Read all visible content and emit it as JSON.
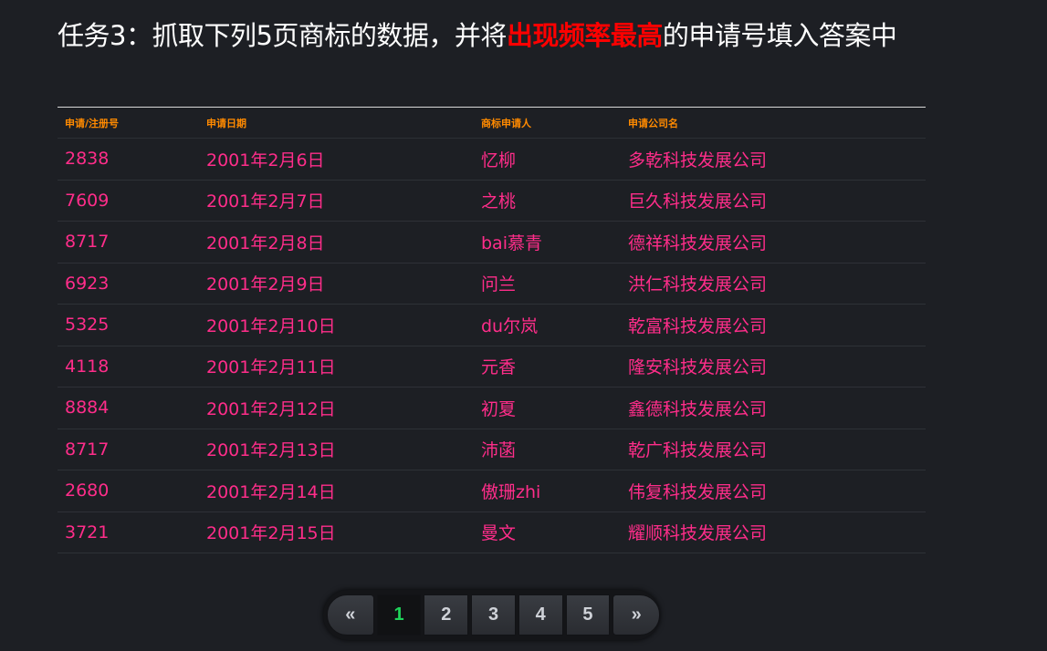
{
  "title": {
    "prefix": "任务3：抓取下列5页商标的数据，并将",
    "highlight": "出现频率最高",
    "suffix": "的申请号填入答案中"
  },
  "table": {
    "headers": [
      "申请/注册号",
      "申请日期",
      "商标申请人",
      "申请公司名"
    ],
    "rows": [
      [
        "2838",
        "2001年2月6日",
        "忆柳",
        "多乾科技发展公司"
      ],
      [
        "7609",
        "2001年2月7日",
        "之桃",
        "巨久科技发展公司"
      ],
      [
        "8717",
        "2001年2月8日",
        "bai慕青",
        "德祥科技发展公司"
      ],
      [
        "6923",
        "2001年2月9日",
        "问兰",
        "洪仁科技发展公司"
      ],
      [
        "5325",
        "2001年2月10日",
        "du尔岚",
        "乾富科技发展公司"
      ],
      [
        "4118",
        "2001年2月11日",
        "元香",
        "隆安科技发展公司"
      ],
      [
        "8884",
        "2001年2月12日",
        "初夏",
        "鑫德科技发展公司"
      ],
      [
        "8717",
        "2001年2月13日",
        "沛菡",
        "乾广科技发展公司"
      ],
      [
        "2680",
        "2001年2月14日",
        "傲珊zhi",
        "伟复科技发展公司"
      ],
      [
        "3721",
        "2001年2月15日",
        "曼文",
        "耀顺科技发展公司"
      ]
    ]
  },
  "pagination": {
    "prev": "«",
    "next": "»",
    "pages": [
      "1",
      "2",
      "3",
      "4",
      "5"
    ],
    "active": "1"
  },
  "colors": {
    "background": "#1d1f24",
    "title": "#ffffff",
    "highlight": "#ff0000",
    "header": "#ff8a00",
    "cell": "#ff2d8a",
    "active_page": "#1fd35a"
  }
}
